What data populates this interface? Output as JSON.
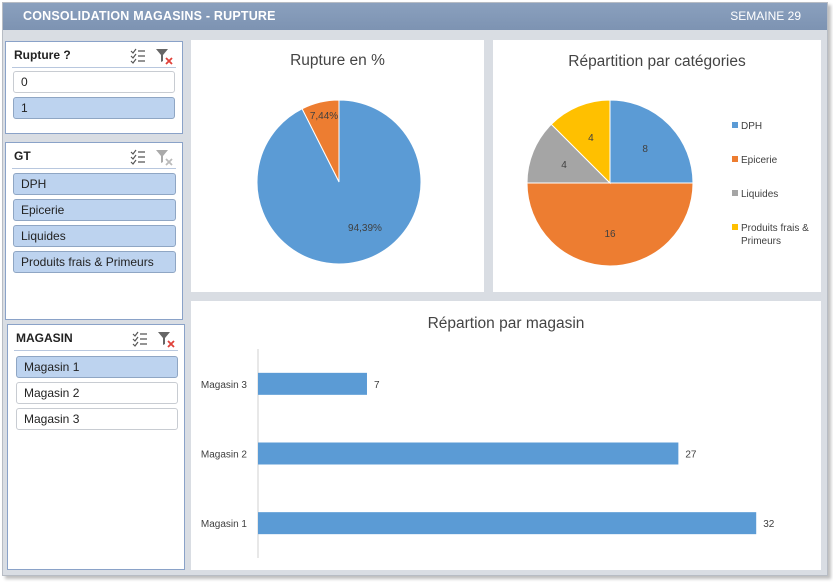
{
  "header": {
    "title": "CONSOLIDATION MAGASINS - RUPTURE",
    "week": "SEMAINE 29"
  },
  "slicers": {
    "rupture": {
      "title": "Rupture ?",
      "items": [
        {
          "label": "0",
          "selected": false
        },
        {
          "label": "1",
          "selected": true
        }
      ]
    },
    "gt": {
      "title": "GT",
      "items": [
        {
          "label": "DPH",
          "selected": true
        },
        {
          "label": "Epicerie",
          "selected": true
        },
        {
          "label": "Liquides",
          "selected": true
        },
        {
          "label": "Produits frais & Primeurs",
          "selected": true
        }
      ]
    },
    "magasin": {
      "title": "MAGASIN",
      "items": [
        {
          "label": "Magasin 1",
          "selected": true
        },
        {
          "label": "Magasin 2",
          "selected": false
        },
        {
          "label": "Magasin 3",
          "selected": false
        }
      ]
    }
  },
  "icons": {
    "multi_select": "multi-select-icon",
    "clear_filter": "clear-filter-icon"
  },
  "colors": {
    "blue": "#5b9bd5",
    "orange": "#ed7d31",
    "gray": "#a5a5a5",
    "yellow": "#ffc000",
    "header": "#7f95b4",
    "selected": "#bdd3ef"
  },
  "chart_data": [
    {
      "type": "pie",
      "title": "Rupture en %",
      "slices": [
        {
          "label": "7,44%",
          "value": 7.44,
          "color": "#ed7d31"
        },
        {
          "label": "94,39%",
          "value": 92.56,
          "color": "#5b9bd5"
        }
      ]
    },
    {
      "type": "pie",
      "title": "Répartition par catégories",
      "legend": "right",
      "slices": [
        {
          "name": "DPH",
          "value": 8,
          "color": "#5b9bd5"
        },
        {
          "name": "Epicerie",
          "value": 16,
          "color": "#ed7d31"
        },
        {
          "name": "Liquides",
          "value": 4,
          "color": "#a5a5a5"
        },
        {
          "name": "Produits frais & Primeurs",
          "value": 4,
          "color": "#ffc000"
        }
      ]
    },
    {
      "type": "bar",
      "orientation": "horizontal",
      "title": "Répartion par magasin",
      "categories": [
        "Magasin 3",
        "Magasin 2",
        "Magasin 1"
      ],
      "values": [
        7,
        27,
        32
      ],
      "xlim": [
        0,
        32.5
      ],
      "color": "#5b9bd5"
    }
  ]
}
